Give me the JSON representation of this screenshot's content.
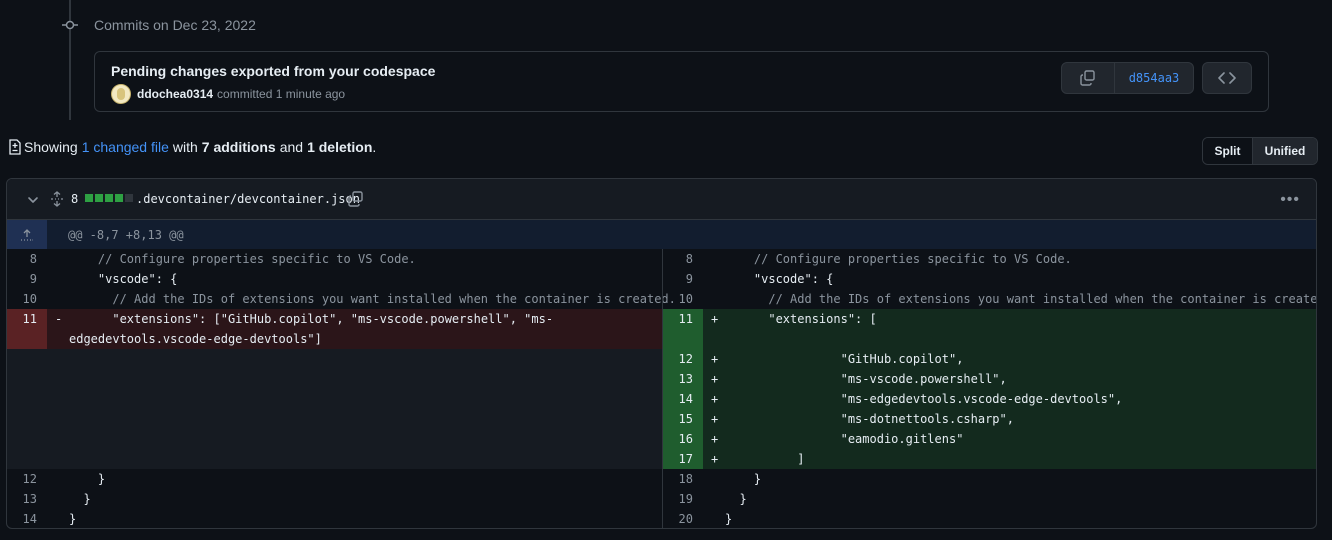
{
  "timeline": {
    "title": "Commits on Dec 23, 2022"
  },
  "commit": {
    "message": "Pending changes exported from your codespace",
    "author": "ddochea0314",
    "meta": "committed 1 minute ago",
    "sha": "d854aa3"
  },
  "summary": {
    "prefix": "Showing",
    "changed": "1 changed file",
    "with": "with",
    "additions": "7 additions",
    "and": "and",
    "deletions": "1 deletion",
    "suffix": "."
  },
  "view_toggle": {
    "split": "Split",
    "unified": "Unified"
  },
  "file": {
    "stat": "8",
    "name": ".devcontainer/devcontainer.json",
    "hunk": "@@ -8,7 +8,13 @@"
  },
  "colors": {
    "added": "#2ea043",
    "removed": "#f85149",
    "neutral": "#30363d",
    "link": "#4493f8"
  },
  "left_lines": [
    {
      "n": "8",
      "sign": "",
      "text": "    // Configure properties specific to VS Code.",
      "type": "ctx"
    },
    {
      "n": "9",
      "sign": "",
      "text": "    \"vscode\": {",
      "type": "ctx"
    },
    {
      "n": "10",
      "sign": "",
      "text": "      // Add the IDs of extensions you want installed when the container is created.",
      "type": "ctx"
    },
    {
      "n": "11",
      "sign": "-",
      "text": "      \"extensions\": [\"GitHub.copilot\", \"ms-vscode.powershell\", \"ms-edgedevtools.vscode-edge-devtools\"]",
      "type": "del"
    },
    {
      "n": "12",
      "sign": "",
      "text": "    }",
      "type": "ctx"
    },
    {
      "n": "13",
      "sign": "",
      "text": "  }",
      "type": "ctx"
    },
    {
      "n": "14",
      "sign": "",
      "text": "}",
      "type": "ctx"
    }
  ],
  "right_lines": [
    {
      "n": "8",
      "sign": "",
      "text": "    // Configure properties specific to VS Code.",
      "type": "ctx"
    },
    {
      "n": "9",
      "sign": "",
      "text": "    \"vscode\": {",
      "type": "ctx"
    },
    {
      "n": "10",
      "sign": "",
      "text": "      // Add the IDs of extensions you want installed when the container is created.",
      "type": "ctx"
    },
    {
      "n": "11",
      "sign": "+",
      "text": "      \"extensions\": [",
      "type": "add"
    },
    {
      "n": "12",
      "sign": "+",
      "text": "                \"GitHub.copilot\",",
      "type": "add"
    },
    {
      "n": "13",
      "sign": "+",
      "text": "                \"ms-vscode.powershell\",",
      "type": "add"
    },
    {
      "n": "14",
      "sign": "+",
      "text": "                \"ms-edgedevtools.vscode-edge-devtools\",",
      "type": "add"
    },
    {
      "n": "15",
      "sign": "+",
      "text": "                \"ms-dotnettools.csharp\",",
      "type": "add"
    },
    {
      "n": "16",
      "sign": "+",
      "text": "                \"eamodio.gitlens\"",
      "type": "add"
    },
    {
      "n": "17",
      "sign": "+",
      "text": "          ]",
      "type": "add"
    },
    {
      "n": "18",
      "sign": "",
      "text": "    }",
      "type": "ctx"
    },
    {
      "n": "19",
      "sign": "",
      "text": "  }",
      "type": "ctx"
    },
    {
      "n": "20",
      "sign": "",
      "text": "}",
      "type": "ctx"
    }
  ]
}
